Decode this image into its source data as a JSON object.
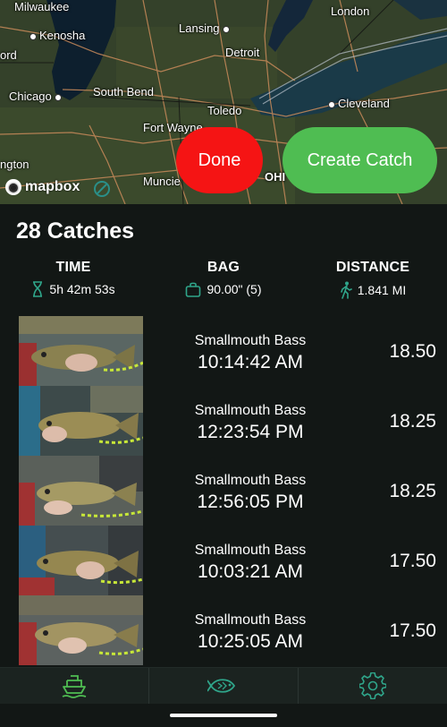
{
  "map": {
    "cities": [
      "Milwaukee",
      "Kenosha",
      "ord",
      "Chicago",
      "South Bend",
      "Fort Wayne",
      "Lansing",
      "Detroit",
      "Toledo",
      "London",
      "Cleveland",
      "ngton",
      "Muncie",
      "OHI"
    ],
    "attribution": "mapbox"
  },
  "buttons": {
    "done": "Done",
    "create": "Create Catch"
  },
  "summary": {
    "title": "28 Catches",
    "time": {
      "label": "TIME",
      "value": "5h 42m 53s",
      "icon": "hourglass-icon"
    },
    "bag": {
      "label": "BAG",
      "value": "90.00\" (5)",
      "icon": "bag-icon"
    },
    "distance": {
      "label": "DISTANCE",
      "value": "1.841 MI",
      "icon": "walking-icon"
    }
  },
  "catches": [
    {
      "species": "Smallmouth Bass",
      "time": "10:14:42 AM",
      "length": "18.50"
    },
    {
      "species": "Smallmouth Bass",
      "time": "12:23:54 PM",
      "length": "18.25"
    },
    {
      "species": "Smallmouth Bass",
      "time": "12:56:05 PM",
      "length": "18.25"
    },
    {
      "species": "Smallmouth Bass",
      "time": "10:03:21 AM",
      "length": "17.50"
    },
    {
      "species": "Smallmouth Bass",
      "time": "10:25:05 AM",
      "length": "17.50"
    }
  ],
  "nav": {
    "tabs": [
      {
        "icon": "boat-icon",
        "active": true
      },
      {
        "icon": "fish-icon",
        "active": false
      },
      {
        "icon": "gear-icon",
        "active": false
      }
    ]
  },
  "colors": {
    "accent": "#4fbd52",
    "done": "#f51414",
    "icon": "#2fa58a",
    "background": "#121715"
  }
}
